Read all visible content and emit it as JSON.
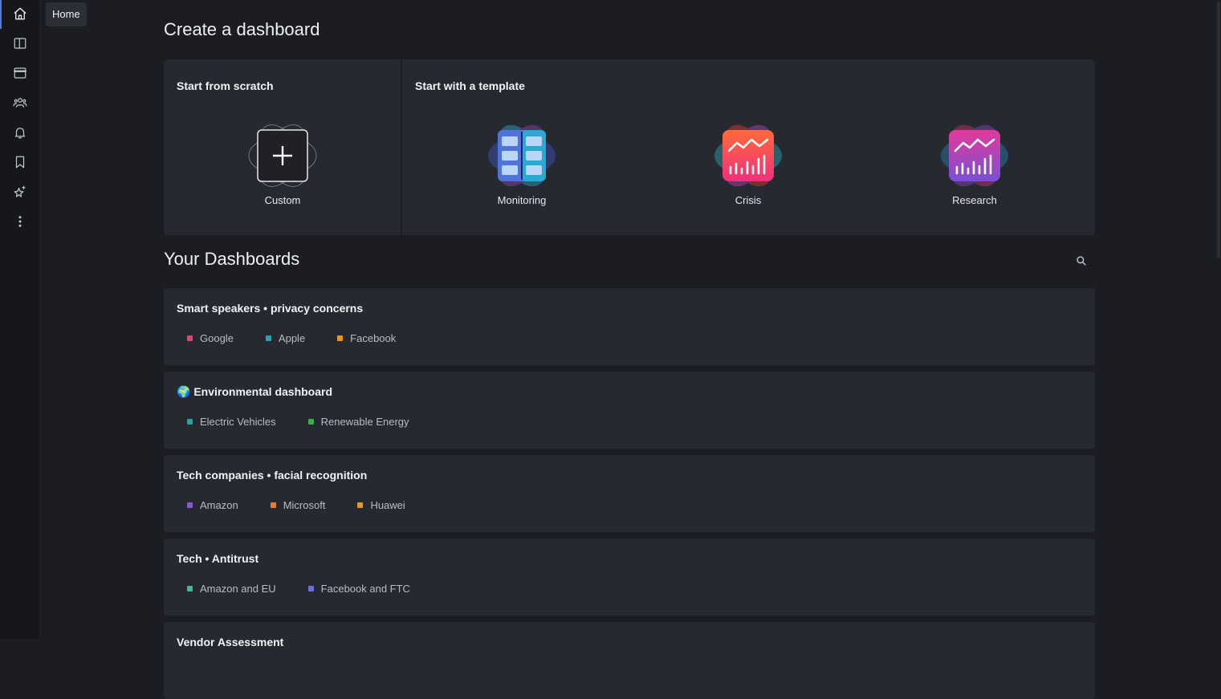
{
  "sidebar": {
    "tooltip": "Home",
    "icons": [
      "home-icon",
      "columns-icon",
      "window-icon",
      "team-icon",
      "bell-icon",
      "bookmark-icon",
      "sparkle-star-icon",
      "more-vertical-icon"
    ]
  },
  "create": {
    "title": "Create a dashboard",
    "scratch_heading": "Start from scratch",
    "template_heading": "Start with a template",
    "custom_label": "Custom",
    "templates": [
      {
        "label": "Monitoring"
      },
      {
        "label": "Crisis"
      },
      {
        "label": "Research"
      }
    ]
  },
  "dashboards": {
    "title": "Your Dashboards",
    "items": [
      {
        "title": "Smart speakers • privacy concerns",
        "tags": [
          {
            "label": "Google",
            "color": "#e0466b"
          },
          {
            "label": "Apple",
            "color": "#1ea5b8"
          },
          {
            "label": "Facebook",
            "color": "#e8961e"
          }
        ]
      },
      {
        "title": "🌍 Environmental dashboard",
        "tags": [
          {
            "label": "Electric Vehicles",
            "color": "#1ea5a5"
          },
          {
            "label": "Renewable Energy",
            "color": "#3fae52"
          }
        ]
      },
      {
        "title": "Tech companies • facial recognition",
        "tags": [
          {
            "label": "Amazon",
            "color": "#8a55d9"
          },
          {
            "label": "Microsoft",
            "color": "#f07a2a"
          },
          {
            "label": "Huawei",
            "color": "#e8961e"
          }
        ]
      },
      {
        "title": "Tech • Antitrust",
        "tags": [
          {
            "label": "Amazon and EU",
            "color": "#3fb8a0"
          },
          {
            "label": "Facebook and FTC",
            "color": "#6b6fd9"
          }
        ]
      },
      {
        "title": "Vendor Assessment",
        "tags": []
      }
    ]
  },
  "colors": {
    "accent": "#4f7dd8",
    "background": "#1b1d22",
    "card": "#262930"
  }
}
